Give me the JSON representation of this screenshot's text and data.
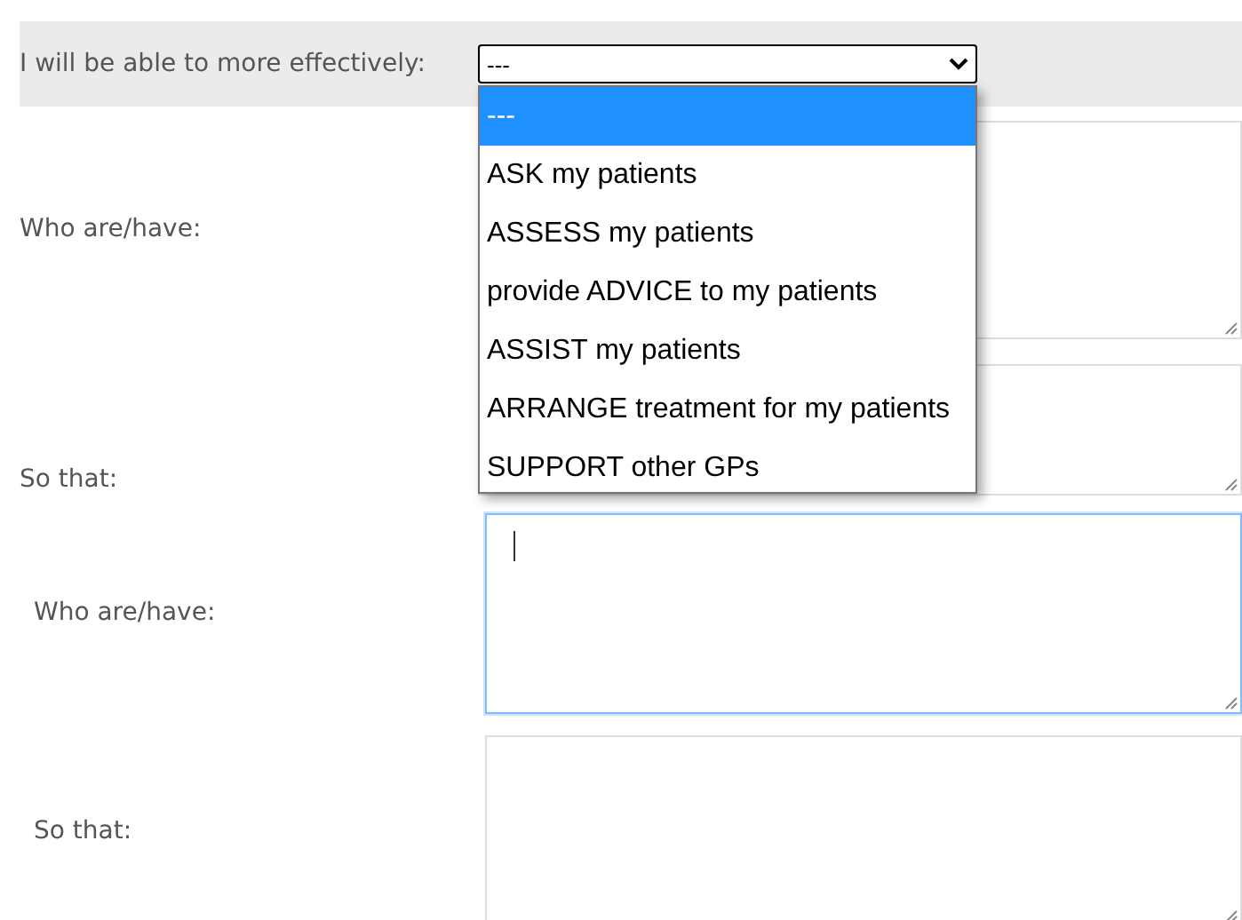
{
  "form": {
    "select_row": {
      "label": "I will be able to more effectively:",
      "value": "---",
      "expanded": true,
      "options": [
        {
          "label": "---",
          "selected": true
        },
        {
          "label": "ASK my patients",
          "selected": false
        },
        {
          "label": "ASSESS my patients",
          "selected": false
        },
        {
          "label": "provide ADVICE to my patients",
          "selected": false
        },
        {
          "label": "ASSIST my patients",
          "selected": false
        },
        {
          "label": "ARRANGE treatment for my patients",
          "selected": false
        },
        {
          "label": "SUPPORT other GPs",
          "selected": false
        }
      ]
    },
    "groups": [
      {
        "fields": [
          {
            "label": "Who are/have:",
            "focused": false
          },
          {
            "label": "So that:",
            "focused": false
          }
        ]
      },
      {
        "fields": [
          {
            "label": "Who are/have:",
            "focused": true
          },
          {
            "label": "So that:",
            "focused": false
          }
        ]
      }
    ]
  }
}
